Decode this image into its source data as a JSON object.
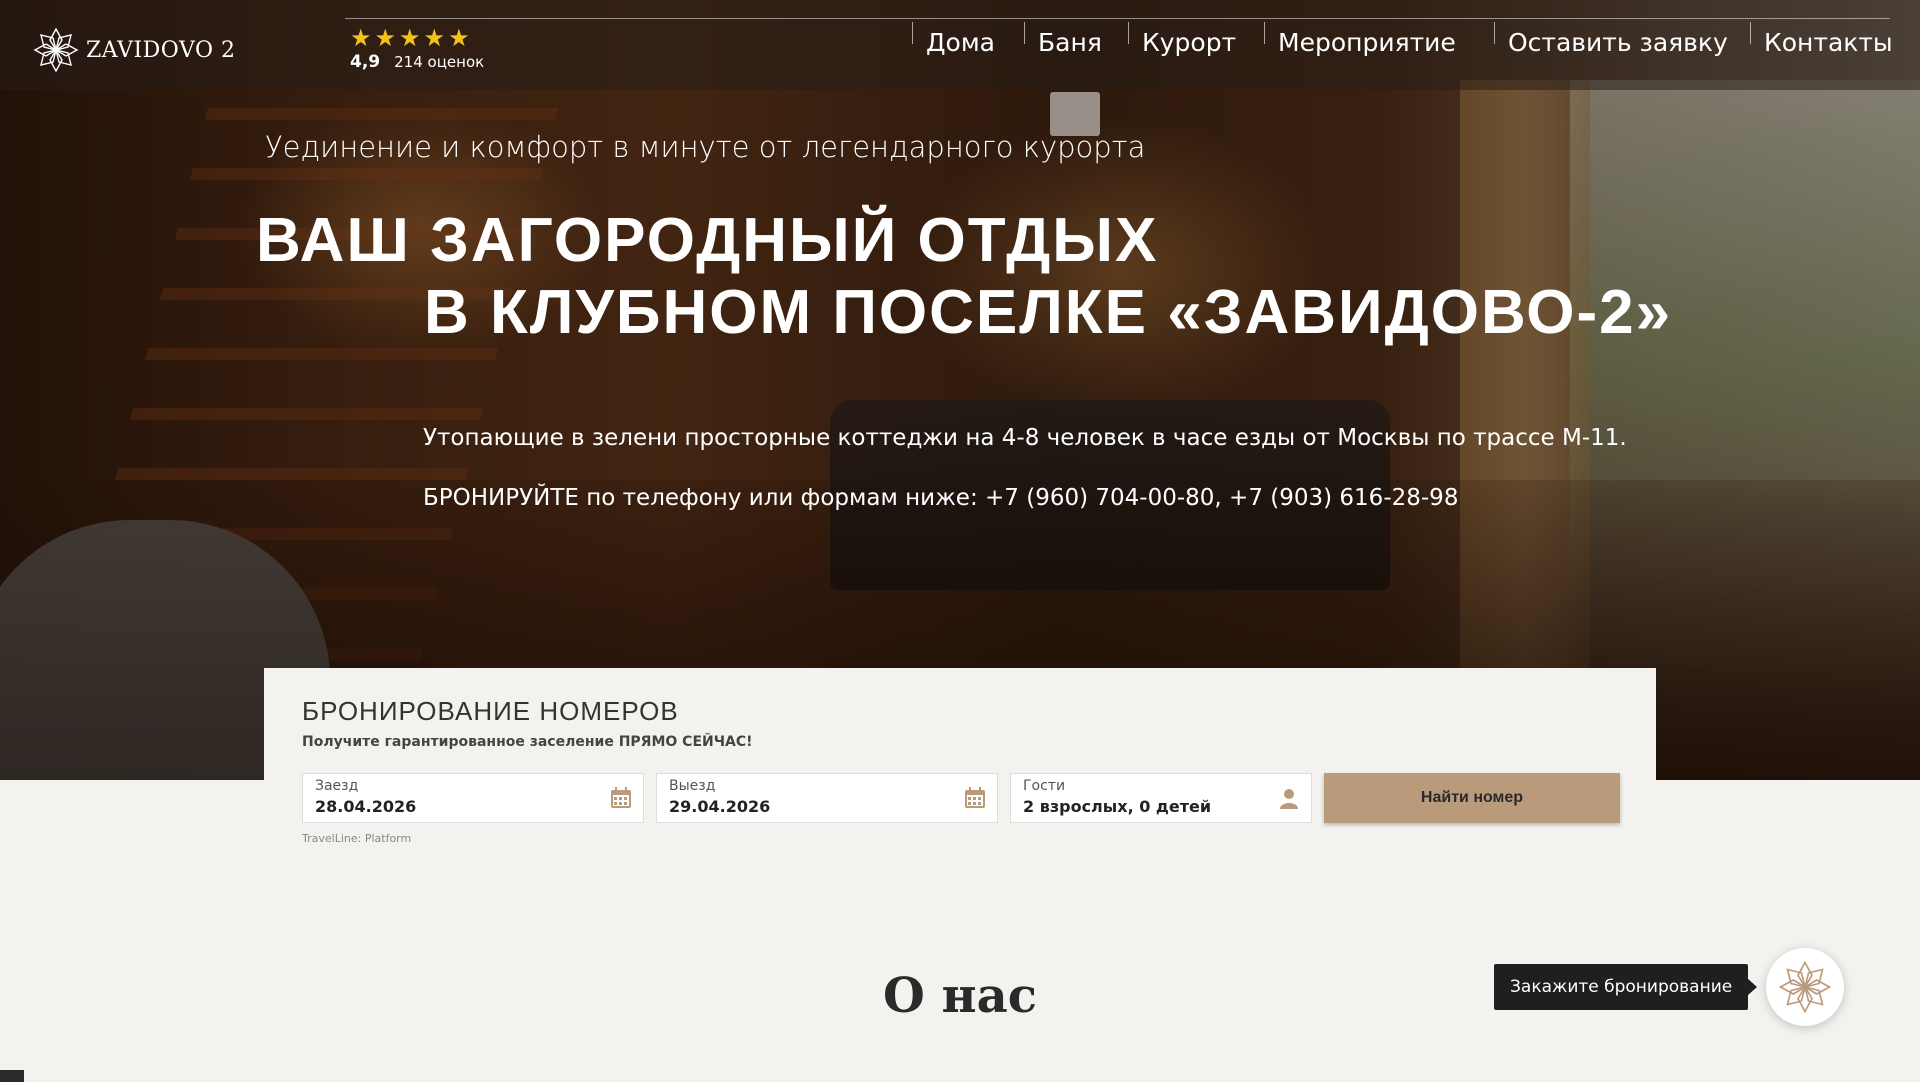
{
  "header": {
    "logo_text": "ZAVIDOVO 2",
    "rating": {
      "stars": 5,
      "score": "4,9",
      "count": "214 оценок"
    },
    "nav": [
      "Дома",
      "Баня",
      "Курорт",
      "Мероприятие",
      "Оставить заявку",
      "Контакты"
    ]
  },
  "hero": {
    "tagline": "Уединение и комфорт в минуте от легендарного курорта",
    "headline_line1": "ВАШ ЗАГОРОДНЫЙ ОТДЫХ",
    "headline_line2": "В КЛУБНОМ ПОСЕЛКЕ «ЗАВИДОВО-2»",
    "description": "Утопающие в зелени просторные коттеджи на 4-8 человек в часе езды от Москвы по трассе М-11.",
    "booking_phone": "БРОНИРУЙТЕ по телефону или формам ниже: +7 (960) 704-00-80, +7 (903) 616-28-98"
  },
  "booking": {
    "title": "БРОНИРОВАНИЕ НОМЕРОВ",
    "subtitle": "Получите гарантированное заселение ПРЯМО СЕЙЧАС!",
    "checkin": {
      "label": "Заезд",
      "value": "28.04.2026"
    },
    "checkout": {
      "label": "Выезд",
      "value": "29.04.2026"
    },
    "guests": {
      "label": "Гости",
      "value": "2 взрослых, 0 детей"
    },
    "search_button": "Найти номер",
    "platform": "TravelLine: Platform"
  },
  "about": {
    "title": "О нас"
  },
  "floating": {
    "tooltip": "Закажите бронирование"
  },
  "colors": {
    "accent": "#b99a7a",
    "star": "#f3c21a",
    "dark": "#1f1f1f"
  }
}
